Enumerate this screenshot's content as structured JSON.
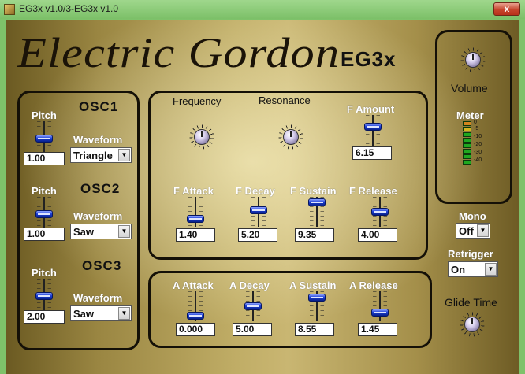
{
  "window": {
    "title": "EG3x v1.0/3-EG3x v1.0",
    "close_label": "x"
  },
  "header": {
    "logo_text": "Electric Gordon",
    "model": "EG3x"
  },
  "oscillators": [
    {
      "title": "OSC1",
      "pitch_label": "Pitch",
      "pitch_value": "1.00",
      "pitch_level": 0.55,
      "waveform_label": "Waveform",
      "waveform_value": "Triangle"
    },
    {
      "title": "OSC2",
      "pitch_label": "Pitch",
      "pitch_value": "1.00",
      "pitch_level": 0.55,
      "waveform_label": "Waveform",
      "waveform_value": "Saw"
    },
    {
      "title": "OSC3",
      "pitch_label": "Pitch",
      "pitch_value": "2.00",
      "pitch_level": 0.55,
      "waveform_label": "Waveform",
      "waveform_value": "Saw"
    }
  ],
  "filter": {
    "frequency_label": "Frequency",
    "resonance_label": "Resonance",
    "amount_label": "F Amount",
    "amount_value": "6.15",
    "attack_label": "F Attack",
    "attack_value": "1.40",
    "decay_label": "F Decay",
    "decay_value": "5.20",
    "sustain_label": "F Sustain",
    "sustain_value": "9.35",
    "release_label": "F Release",
    "release_value": "4.00"
  },
  "amp": {
    "attack_label": "A Attack",
    "attack_value": "0.000",
    "decay_label": "A Decay",
    "decay_value": "5.00",
    "sustain_label": "A Sustain",
    "sustain_value": "8.55",
    "release_label": "A Release",
    "release_value": "1.45"
  },
  "output": {
    "volume_label": "Volume",
    "meter_label": "Meter",
    "meter_scale": [
      "0",
      "-5",
      "-10",
      "-20",
      "-30",
      "-40"
    ]
  },
  "mono": {
    "label": "Mono",
    "value": "Off"
  },
  "retrigger": {
    "label": "Retrigger",
    "value": "On"
  },
  "glide": {
    "label": "Glide Time"
  },
  "colors": {
    "panel_border": "#141007",
    "slider_thumb": "#1c3fd6",
    "meter_green": "#1fa81f",
    "meter_orange": "#d2841e"
  },
  "icons": [
    "knob-icon",
    "slider-thumb",
    "dropdown-arrow-icon",
    "close-icon"
  ]
}
